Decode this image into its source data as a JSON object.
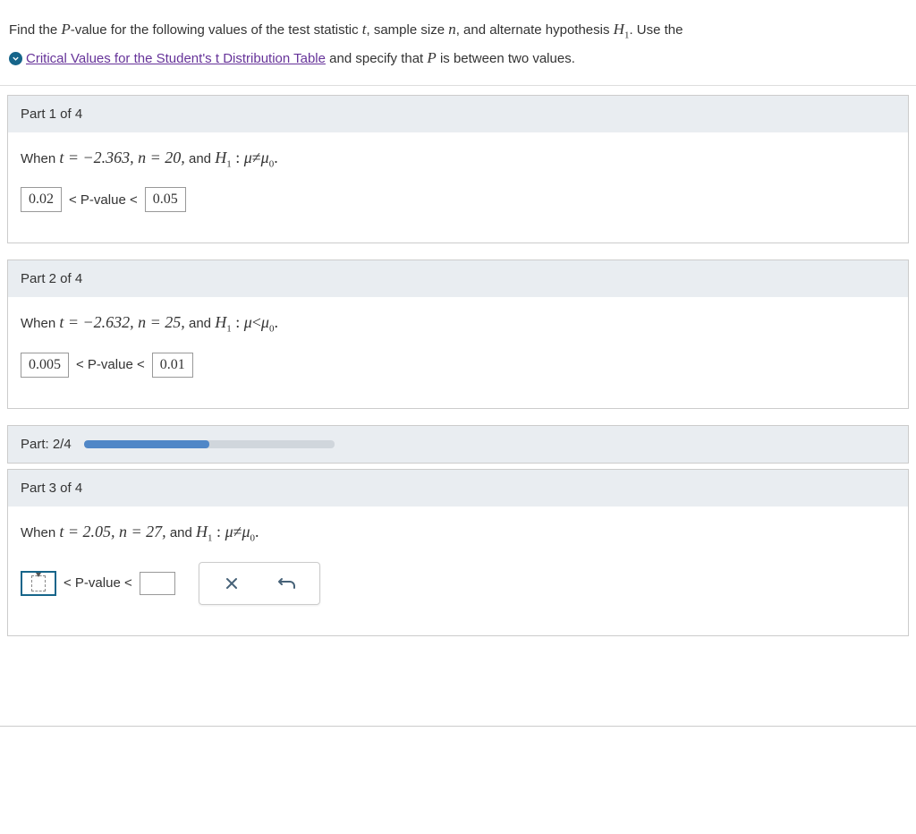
{
  "intro": {
    "prefix": "Find the ",
    "pvar": "P",
    "mid1": "-value for the following values of the test statistic ",
    "tvar": "t",
    "mid2": ", sample size ",
    "nvar": "n",
    "mid3": ", and alternate hypothesis ",
    "h1var": "H",
    "h1sub": "1",
    "suffix": ". Use the",
    "link": "Critical Values for the Student's t Distribution Table",
    "after_link": " and specify that ",
    "pvar2": "P",
    "after_p2": " is between two values."
  },
  "parts": [
    {
      "header": "Part 1 of 4",
      "when_prefix": "When ",
      "t_eq": "t = −2.363, ",
      "n_eq": "n = 20,",
      "and": "  and ",
      "h1_label": "H",
      "h1_sub": "1",
      "colon": " : ",
      "mu": "μ",
      "rel": "≠",
      "mu0": "μ",
      "mu0_sub": "0",
      "dot": ".",
      "lower": "0.02",
      "upper": "0.05",
      "pvalue_label": "< P-value <",
      "mode": "filled"
    },
    {
      "header": "Part 2 of 4",
      "when_prefix": "When ",
      "t_eq": "t = −2.632, ",
      "n_eq": "n = 25,",
      "and": "  and ",
      "h1_label": "H",
      "h1_sub": "1",
      "colon": " : ",
      "mu": "μ",
      "rel": "<",
      "mu0": "μ",
      "mu0_sub": "0",
      "dot": ".",
      "lower": "0.005",
      "upper": "0.01",
      "pvalue_label": "< P-value <",
      "mode": "filled"
    }
  ],
  "progress": {
    "label": "Part: 2/4",
    "percent": 50
  },
  "part3": {
    "header": "Part 3 of 4",
    "when_prefix": "When ",
    "t_eq": "t = 2.05, ",
    "n_eq": "n = 27,",
    "and": "  and ",
    "h1_label": "H",
    "h1_sub": "1",
    "colon": " : ",
    "mu": "μ",
    "rel": "≠",
    "mu0": "μ",
    "mu0_sub": "0",
    "dot": ".",
    "pvalue_label": "< P-value <"
  }
}
